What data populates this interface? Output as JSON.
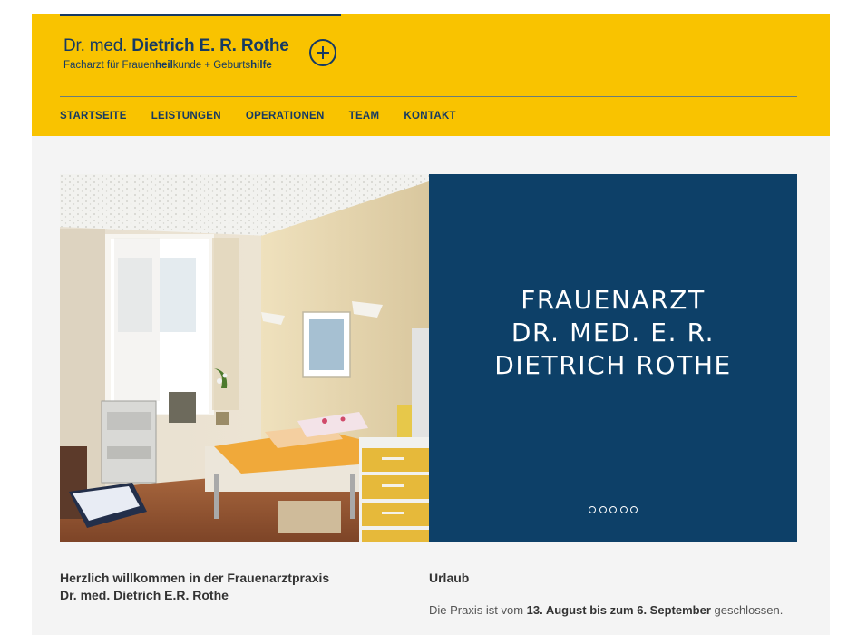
{
  "header": {
    "logo": {
      "prefix": "Dr. med.",
      "name": "Dietrich E. R. Rothe",
      "subtitle_parts": [
        "Facharzt für Frauen",
        "heil",
        "kunde + Geburts",
        "hilfe"
      ]
    },
    "plus_icon": "plus-circle-icon"
  },
  "nav": {
    "items": [
      "STARTSEITE",
      "LEISTUNGEN",
      "OPERATIONEN",
      "TEAM",
      "KONTAKT"
    ]
  },
  "hero": {
    "image": "examination-room-photo",
    "title_lines": [
      "FRAUENARZT",
      "DR. MED. E. R.",
      "DIETRICH ROTHE"
    ],
    "slide_count": 5
  },
  "welcome": {
    "lines": [
      "Herzlich willkommen in der Frauenarztpraxis",
      "Dr. med. Dietrich E.R. Rothe"
    ]
  },
  "vacation": {
    "title": "Urlaub",
    "text_before": "Die Praxis ist vom ",
    "dates": "13. August bis zum 6. September",
    "text_after": " geschlossen."
  },
  "colors": {
    "header_bg": "#f9c300",
    "brand_navy": "#163a63",
    "hero_panel": "#0d4068",
    "page_bg": "#f4f4f4"
  }
}
